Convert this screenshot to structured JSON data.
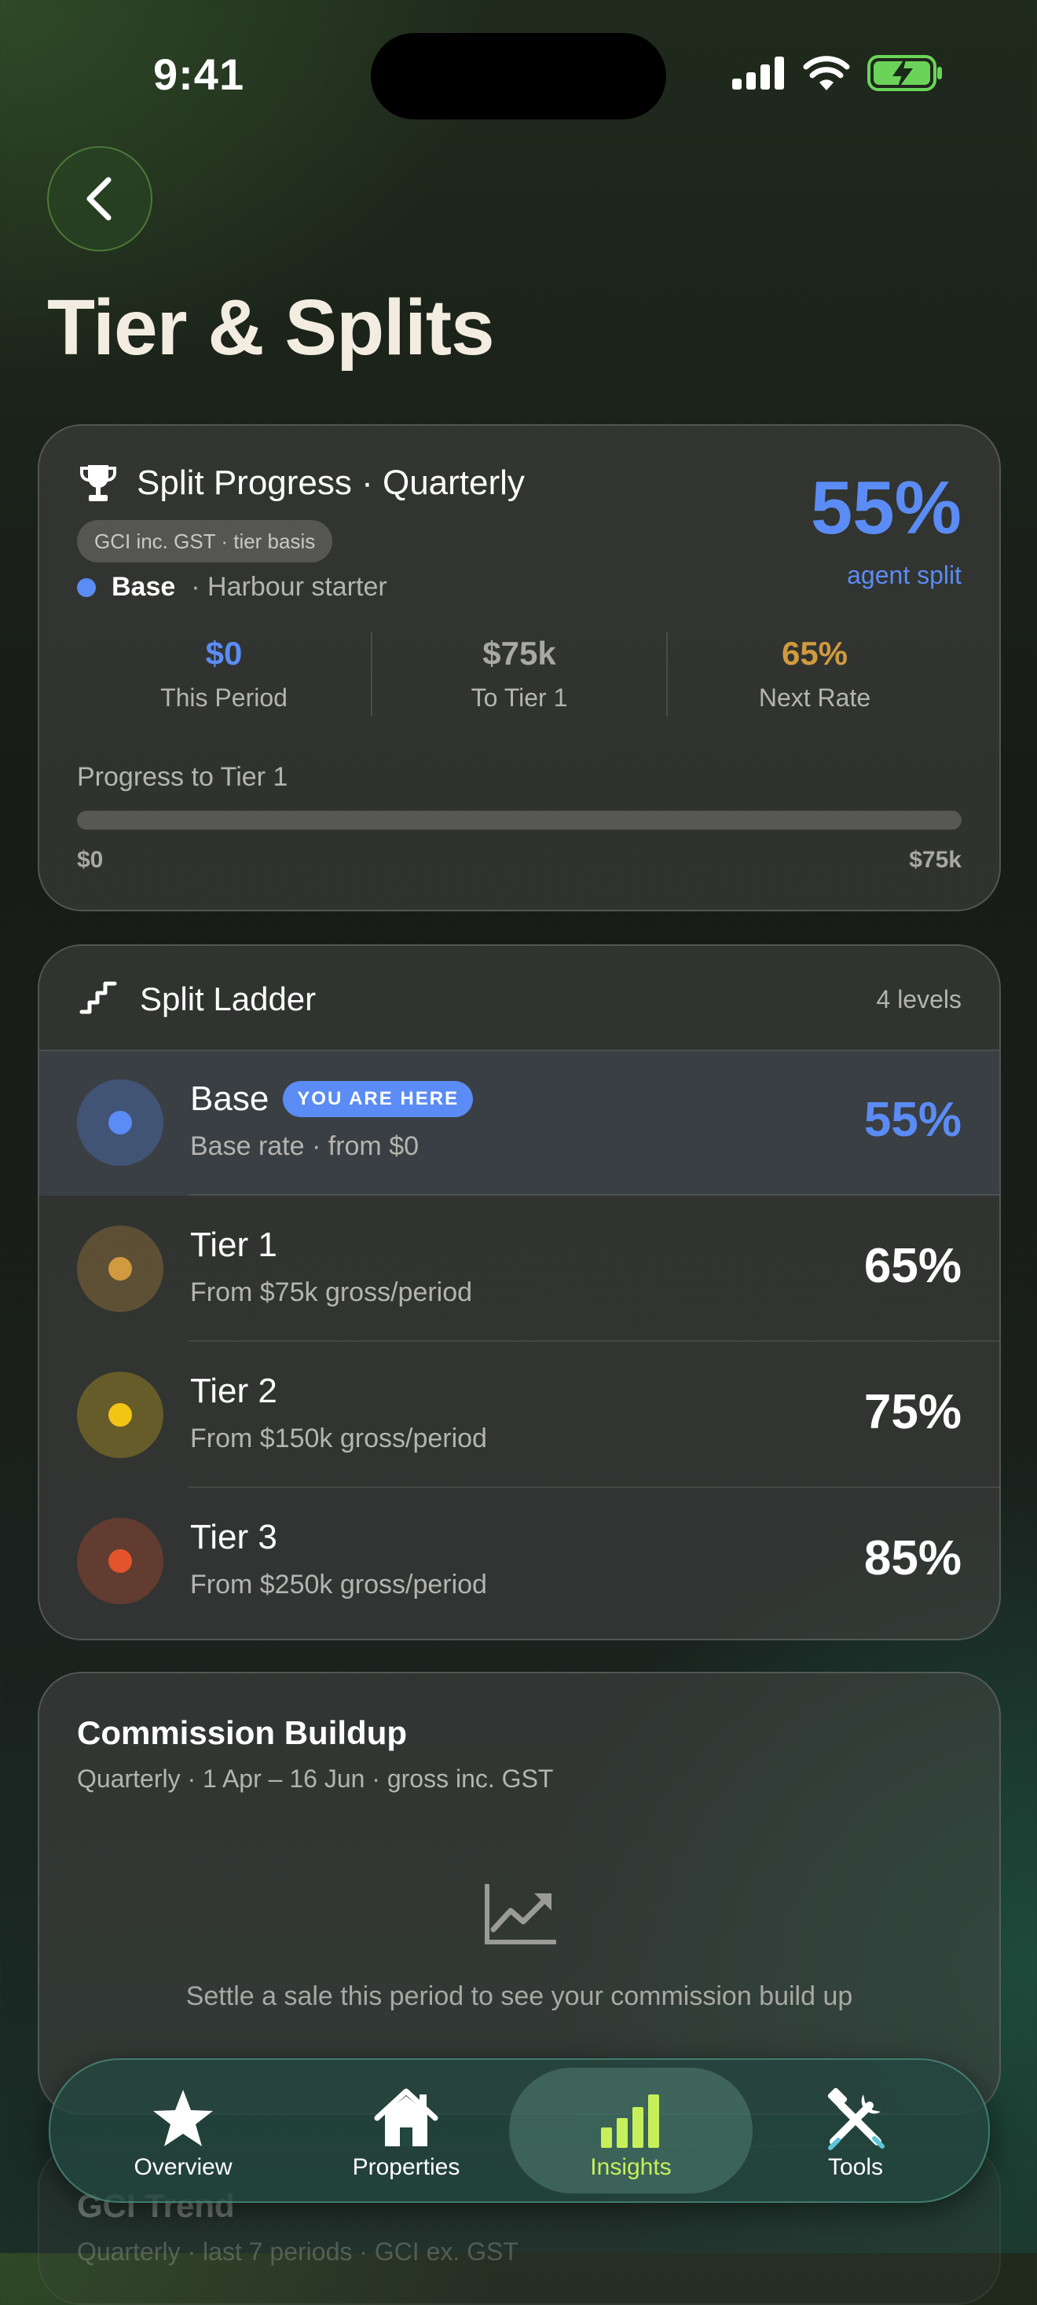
{
  "status_bar": {
    "time": "9:41"
  },
  "header": {
    "title": "Tier & Splits"
  },
  "split_progress": {
    "title": "Split Progress · Quarterly",
    "basis_pill": "GCI inc. GST · tier basis",
    "current_tier": "Base",
    "current_tier_desc": "· Harbour starter",
    "agent_split_pct": "55%",
    "agent_split_label": "agent split",
    "stats": [
      {
        "value": "$0",
        "label": "This Period",
        "color": "#5b8cf5"
      },
      {
        "value": "$75k",
        "label": "To Tier 1",
        "color": "#a8a8a4"
      },
      {
        "value": "65%",
        "label": "Next Rate",
        "color": "#d19a3f"
      }
    ],
    "progress_label": "Progress to Tier 1",
    "progress_fraction": 0,
    "progress_min": "$0",
    "progress_max": "$75k"
  },
  "ladder": {
    "title": "Split Ladder",
    "count": "4 levels",
    "current_badge": "YOU ARE HERE",
    "levels": [
      {
        "name": "Base",
        "desc": "Base rate · from $0",
        "pct": "55%",
        "color": "#5b8cf5",
        "current": true
      },
      {
        "name": "Tier 1",
        "desc": "From $75k gross/period",
        "pct": "65%",
        "color": "#d19a3f",
        "current": false
      },
      {
        "name": "Tier 2",
        "desc": "From $150k gross/period",
        "pct": "75%",
        "color": "#f2c414",
        "current": false
      },
      {
        "name": "Tier 3",
        "desc": "From $250k gross/period",
        "pct": "85%",
        "color": "#e4542c",
        "current": false
      }
    ]
  },
  "commission": {
    "title": "Commission Buildup",
    "subtitle": "Quarterly · 1 Apr – 16 Jun · gross inc. GST",
    "empty_text": "Settle a sale this period to see your commission build up"
  },
  "gci_trend": {
    "title": "GCI Trend",
    "subtitle": "Quarterly · last 7 periods · GCI ex. GST"
  },
  "tabbar": {
    "tabs": [
      {
        "label": "Overview",
        "icon": "star-icon",
        "active": false
      },
      {
        "label": "Properties",
        "icon": "house-icon",
        "active": false
      },
      {
        "label": "Insights",
        "icon": "bar-chart-icon",
        "active": true
      },
      {
        "label": "Tools",
        "icon": "tools-icon",
        "active": false
      }
    ]
  },
  "colors": {
    "accent": "#5b8cf5",
    "active_tab": "#c6ef5a"
  }
}
